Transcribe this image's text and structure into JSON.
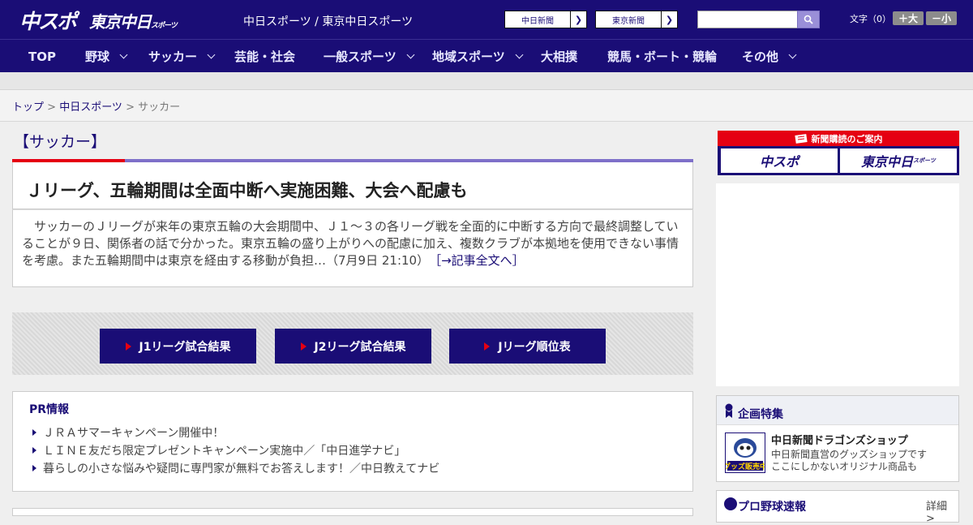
{
  "header": {
    "logo_chuspo": "中スポ",
    "logo_tokyo": "東京中日",
    "logo_tokyo_sub": "スポーツ",
    "site_link_1": "中日スポーツ",
    "site_sep": " / ",
    "site_link_2": "東京中日スポーツ",
    "btn_chunichi": "中日新聞",
    "btn_tokyo": "東京新聞",
    "search_placeholder": "",
    "font_size_label": "文字（0）",
    "font_larger": "＋大",
    "font_smaller": "－小"
  },
  "nav": {
    "items": [
      "TOP",
      "野球",
      "サッカー",
      "芸能・社会",
      "一般スポーツ",
      "地域スポーツ",
      "大相撲",
      "競馬・ボート・競輪",
      "その他"
    ]
  },
  "breadcrumb": {
    "top": "トップ",
    "sep": " > ",
    "section": "中日スポーツ",
    "current": "サッカー"
  },
  "section_title": "【サッカー】",
  "article": {
    "title": "Ｊリーグ、五輪期間は全面中断へ実施困難、大会へ配慮も",
    "body": "　サッカーのＪリーグが来年の東京五輪の大会期間中、Ｊ１～３の各リーグ戦を全面的に中断する方向で最終調整していることが９日、関係者の話で分かった。東京五輪の盛り上がりへの配慮に加え、複数クラブが本拠地を使用できない事情を考慮。また五輪期間中は東京を経由する移動が負担…（7月9日 21:10）",
    "more": "［→記事全文へ］"
  },
  "jleague_buttons": [
    "J1リーグ試合結果",
    "J2リーグ試合結果",
    "Jリーグ順位表"
  ],
  "pr": {
    "title": "PR情報",
    "items": [
      "ＪＲＡサマーキャンペーン開催中！",
      "ＬＩＮＥ友だち限定プレゼントキャンペーン実施中／「中日進学ナビ」",
      "暮らしの小さな悩みや疑問に専門家が無料でお答えします！／中日教えてナビ"
    ]
  },
  "sidebar": {
    "subscribe_head": "新聞購読のご案内",
    "subscribe_logo_1": "中スポ",
    "subscribe_logo_2": "東京中日",
    "subscribe_logo_2_sub": "スポーツ",
    "kikaku_title": "企画特集",
    "shop_name": "中日新聞ドラゴンズショップ",
    "shop_desc_1": "中日新聞直営のグッズショップです",
    "shop_desc_2": "ここにしかないオリジナル商品も",
    "shop_thumb_label": "グッズ販売中",
    "yakyu_title": "プロ野球速報",
    "yakyu_more": "詳細 >"
  },
  "colors": {
    "brand_navy": "#1a0d76",
    "accent_red": "#e50012",
    "accent_purple": "#7e70c9"
  }
}
